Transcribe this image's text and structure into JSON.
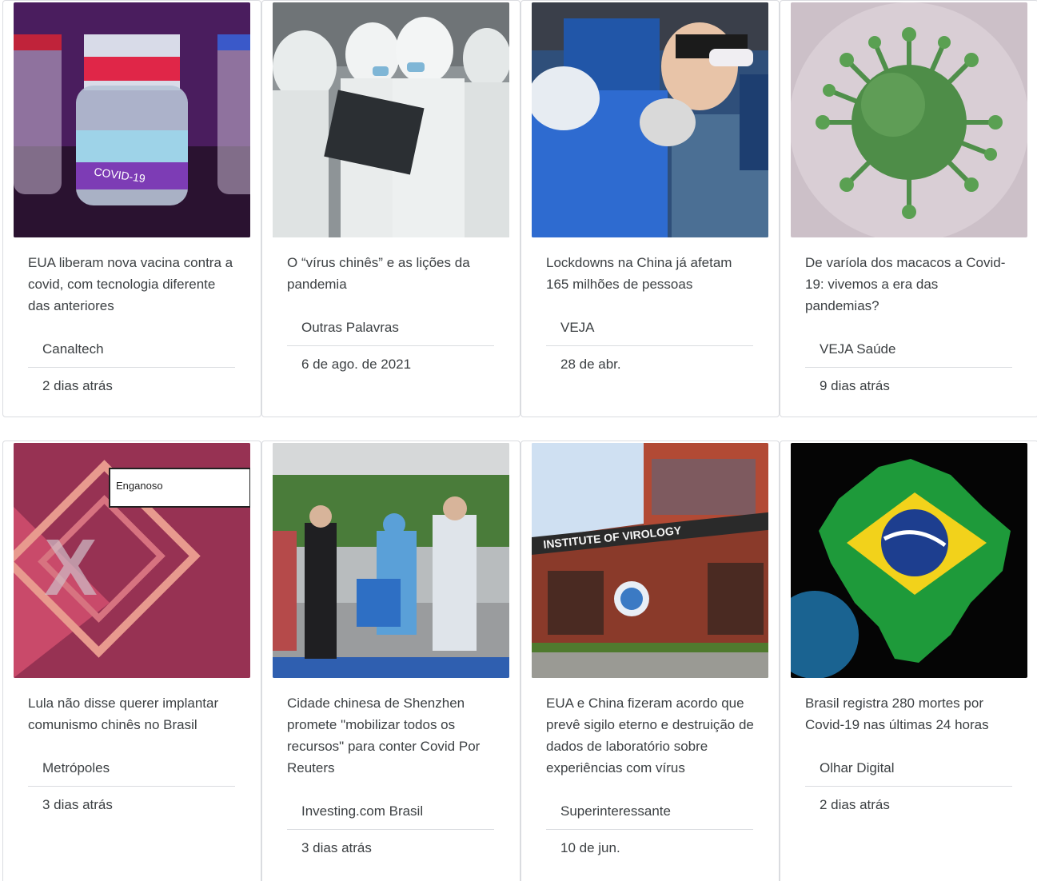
{
  "cards": [
    {
      "title": "EUA liberam nova vacina contra a covid, com tecnologia diferente das anteriores",
      "source": "Canaltech",
      "date": "2 dias atrás",
      "image": "covid-vaccine-vials-image"
    },
    {
      "title": "O “vírus chinês” e as lições da pandemia",
      "source": "Outras Palavras",
      "date": "6 de ago. de 2021",
      "image": "doctors-in-protective-suits-image"
    },
    {
      "title": "Lockdowns na China já afetam 165 milhões de pessoas",
      "source": "VEJA",
      "date": "28 de abr.",
      "image": "child-covid-test-image"
    },
    {
      "title": "De varíola dos macacos a Covid-19: vivemos a era das pandemias?",
      "source": "VEJA Saúde",
      "date": "9 dias atrás",
      "image": "green-virus-image"
    },
    {
      "title": "Lula não disse querer implantar comunismo chinês no Brasil",
      "source": "Metrópoles",
      "date": "3 dias atrás",
      "image": "fact-check-enganoso-image",
      "image_label": "Enganoso"
    },
    {
      "title": "Cidade chinesa de Shenzhen promete \"mobilizar todos os recursos\" para conter Covid Por Reuters",
      "source": "Investing.com Brasil",
      "date": "3 dias atrás",
      "image": "testing-queue-image"
    },
    {
      "title": "EUA e China fizeram acordo que prevê sigilo eterno e destruição de dados de laboratório sobre experiências com vírus",
      "source": "Superinteressante",
      "date": "10 de jun.",
      "image": "wuhan-institute-image",
      "image_label": "INSTITUTE OF VIROLOGY"
    },
    {
      "title": "Brasil registra 280 mortes por Covid-19 nas últimas 24 horas",
      "source": "Olhar Digital",
      "date": "2 dias atrás",
      "image": "brazil-flag-map-image"
    }
  ],
  "colors": {
    "border": "#dadce0",
    "text": "#3c4043"
  }
}
